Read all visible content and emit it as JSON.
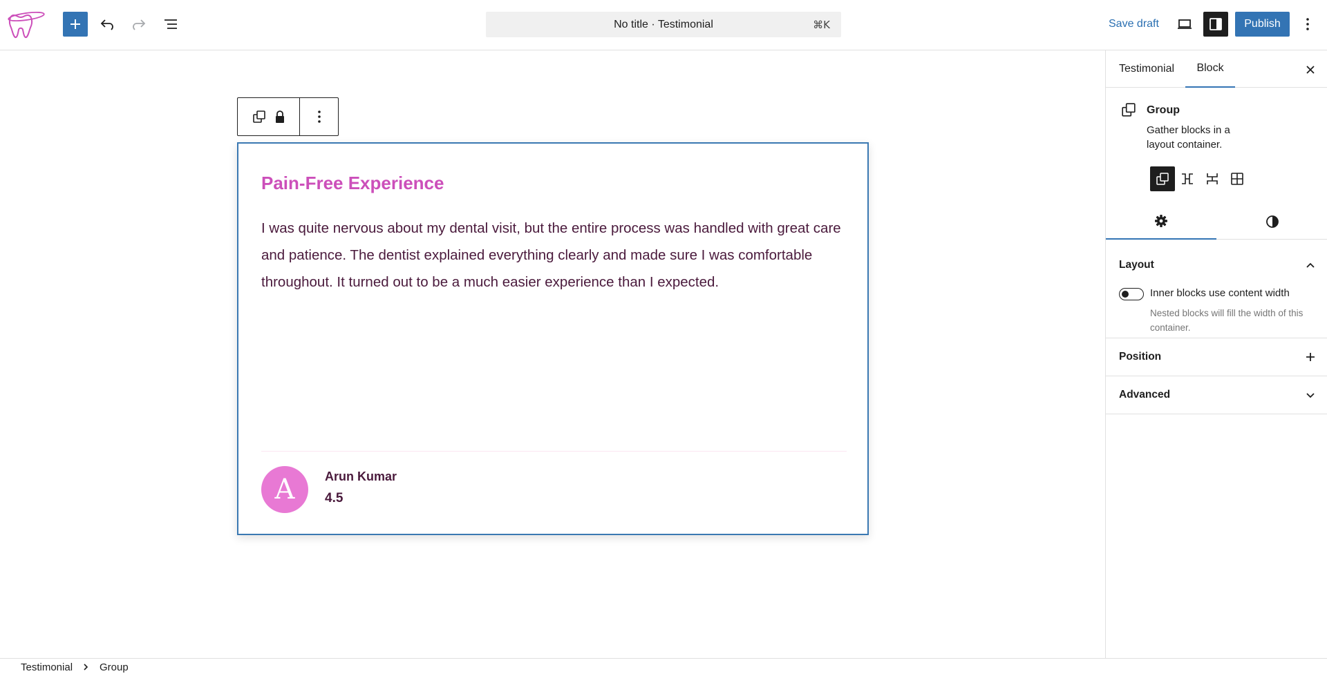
{
  "toolbar": {
    "document_title": "No title · Testimonial",
    "shortcut": "⌘K",
    "save_draft_label": "Save draft",
    "publish_label": "Publish",
    "accent_color": "#3374b4"
  },
  "block": {
    "title": "Pain-Free Experience",
    "body": "I was quite nervous about my dental visit, but the entire process was handled with great care and patience. The dentist explained everything clearly and made sure I was comfortable throughout. It turned out to be a much easier experience than I expected.",
    "avatar_letter": "A",
    "author_name": "Arun Kumar",
    "rating": "4.5",
    "title_color": "#cc4fba",
    "text_color": "#4a1a3c",
    "avatar_color": "#e879d4"
  },
  "sidebar": {
    "tabs": [
      {
        "label": "Testimonial"
      },
      {
        "label": "Block"
      }
    ],
    "card": {
      "title": "Group",
      "description": "Gather blocks in a layout container."
    },
    "panels": {
      "layout_title": "Layout",
      "toggle_label": "Inner blocks use content width",
      "toggle_help": "Nested blocks will fill the width of this container.",
      "position_title": "Position",
      "advanced_title": "Advanced"
    }
  },
  "breadcrumb": {
    "items": [
      {
        "label": "Testimonial"
      },
      {
        "label": "Group"
      }
    ]
  }
}
